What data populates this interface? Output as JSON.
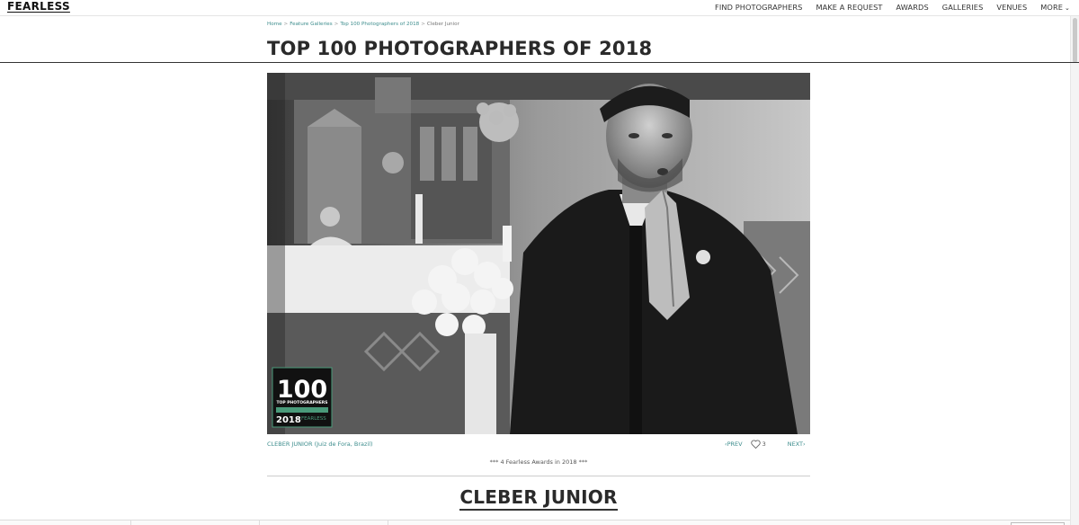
{
  "header": {
    "logo": "FEARLESS",
    "nav": [
      {
        "label": "FIND PHOTOGRAPHERS"
      },
      {
        "label": "MAKE A REQUEST"
      },
      {
        "label": "AWARDS"
      },
      {
        "label": "GALLERIES"
      },
      {
        "label": "VENUES"
      },
      {
        "label": "MORE"
      }
    ]
  },
  "breadcrumb": {
    "items": [
      "Home",
      "Feature Galleries",
      "Top 100 Photographers of 2018",
      "Cleber Junior"
    ],
    "separator": ">"
  },
  "page": {
    "title": "TOP 100 PHOTOGRAPHERS OF 2018"
  },
  "photo": {
    "badge_number": "100",
    "badge_line": "TOP PHOTOGRAPHERS",
    "badge_year": "2018",
    "badge_brand": "FEARLESS"
  },
  "caption": {
    "credit": "CLEBER JUNIOR (Juiz de Fora, Brazil)",
    "prev": "PREV",
    "likes": "3",
    "next": "NEXT"
  },
  "awards_note": "*** 4 Fearless Awards in 2018 ***",
  "photographer": {
    "name": "CLEBER JUNIOR"
  },
  "colors": {
    "link": "#3d8d8d",
    "text": "#2a2a2a",
    "badge_green": "#4a9a7a"
  }
}
